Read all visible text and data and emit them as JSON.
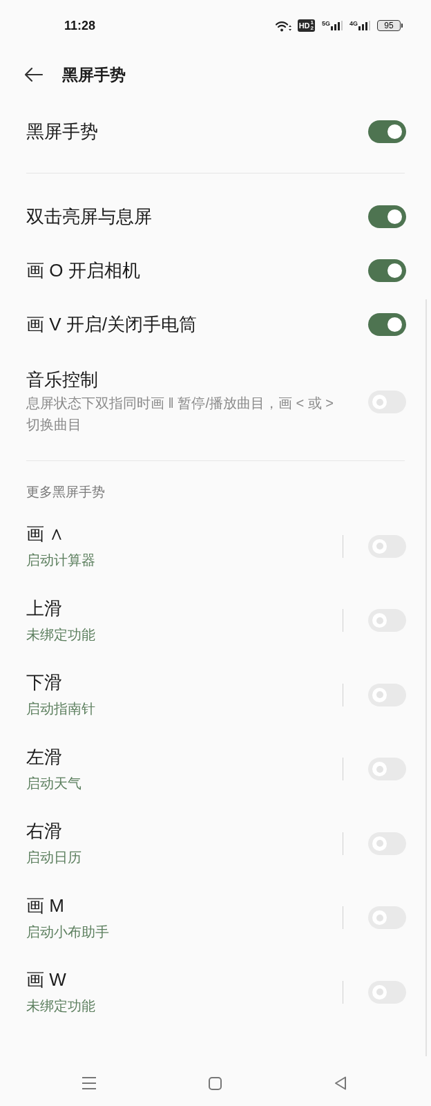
{
  "status_bar": {
    "time": "11:28",
    "hd_badge": {
      "label": "HD",
      "sims": [
        "1",
        "2"
      ]
    },
    "networks": [
      {
        "label": "5G"
      },
      {
        "label": "4G"
      }
    ],
    "battery": "95"
  },
  "header": {
    "title": "黑屏手势"
  },
  "master": {
    "label": "黑屏手势",
    "on": true
  },
  "gestures": [
    {
      "label": "双击亮屏与息屏",
      "on": true
    },
    {
      "label": "画 O 开启相机",
      "on": true
    },
    {
      "label": "画 V 开启/关闭手电筒",
      "on": true
    },
    {
      "label": "音乐控制",
      "description": "息屏状态下双指同时画 ‖ 暂停/播放曲目，画 < 或 > 切换曲目",
      "on": false
    }
  ],
  "more_section": {
    "heading": "更多黑屏手势",
    "items": [
      {
        "label": "画 ∧",
        "action": "启动计算器",
        "on": false
      },
      {
        "label": "上滑",
        "action": "未绑定功能",
        "on": false
      },
      {
        "label": "下滑",
        "action": "启动指南针",
        "on": false
      },
      {
        "label": "左滑",
        "action": "启动天气",
        "on": false
      },
      {
        "label": "右滑",
        "action": "启动日历",
        "on": false
      },
      {
        "label": "画 M",
        "action": "启动小布助手",
        "on": false
      },
      {
        "label": "画 W",
        "action": "未绑定功能",
        "on": false
      }
    ]
  }
}
